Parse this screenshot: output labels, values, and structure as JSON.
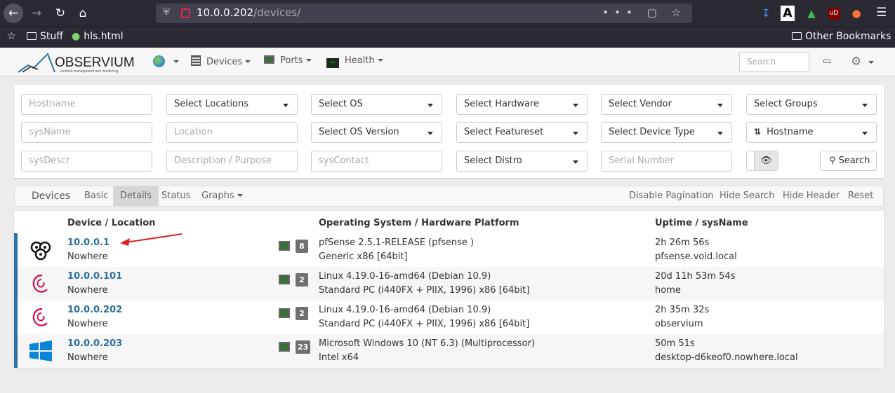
{
  "browser": {
    "url_host": "10.0.0.202",
    "url_path": "/devices/",
    "bookmarks": [
      "Stuff",
      "hls.html"
    ],
    "other_bookmarks": "Other Bookmarks",
    "ext_a_label": "A",
    "ext_ub_label": "uD"
  },
  "app": {
    "logo_text": "OBSERVIUM",
    "logo_sub": "network management and monitoring",
    "nav": {
      "devices": "Devices",
      "ports": "Ports",
      "health": "Health"
    },
    "search_placeholder": "Search"
  },
  "filters": {
    "row1": {
      "hostname": "Hostname",
      "locations": "Select Locations",
      "os": "Select OS",
      "hardware": "Select Hardware",
      "vendor": "Select Vendor",
      "groups": "Select Groups"
    },
    "row2": {
      "sysname": "sysName",
      "location": "Location",
      "os_version": "Select OS Version",
      "featureset": "Select Featureset",
      "device_type": "Select Device Type",
      "sort": "Hostname"
    },
    "row3": {
      "sysdescr": "sysDescr",
      "purpose": "Description / Purpose",
      "syscontact": "sysContact",
      "distro": "Select Distro",
      "serial": "Serial Number"
    },
    "search_button": "Search"
  },
  "tabs": {
    "title": "Devices",
    "items": [
      "Basic",
      "Details",
      "Status",
      "Graphs"
    ],
    "active": "Details",
    "right": [
      "Disable Pagination",
      "Hide Search",
      "Hide Header",
      "Reset"
    ]
  },
  "table": {
    "headers": {
      "device": "Device / Location",
      "os": "Operating System / Hardware Platform",
      "uptime": "Uptime / sysName"
    },
    "rows": [
      {
        "host": "10.0.0.1",
        "location": "Nowhere",
        "ports": "8",
        "os": "pfSense 2.5.1-RELEASE (pfsense )",
        "hardware": "Generic x86 [64bit]",
        "uptime": "2h 26m 56s",
        "sysname": "pfsense.void.local",
        "os_icon": "pfsense-icon"
      },
      {
        "host": "10.0.0.101",
        "location": "Nowhere",
        "ports": "2",
        "os": "Linux 4.19.0-16-amd64 (Debian 10.9)",
        "hardware": "Standard PC (i440FX + PIIX, 1996) x86 [64bit]",
        "uptime": "20d 11h 53m 54s",
        "sysname": "home",
        "os_icon": "debian-icon"
      },
      {
        "host": "10.0.0.202",
        "location": "Nowhere",
        "ports": "2",
        "os": "Linux 4.19.0-16-amd64 (Debian 10.9)",
        "hardware": "Standard PC (i440FX + PIIX, 1996) x86 [64bit]",
        "uptime": "2h 35m 32s",
        "sysname": "observium",
        "os_icon": "debian-icon"
      },
      {
        "host": "10.0.0.203",
        "location": "Nowhere",
        "ports": "23",
        "os": "Microsoft Windows 10 (NT 6.3) (Multiprocessor)",
        "hardware": "Intel x64",
        "uptime": "50m 51s",
        "sysname": "desktop-d6keof0.nowhere.local",
        "os_icon": "windows-icon"
      }
    ]
  },
  "colors": {
    "accent": "#2a73a8",
    "link": "#2a6e9e",
    "arrow": "#e02020"
  }
}
